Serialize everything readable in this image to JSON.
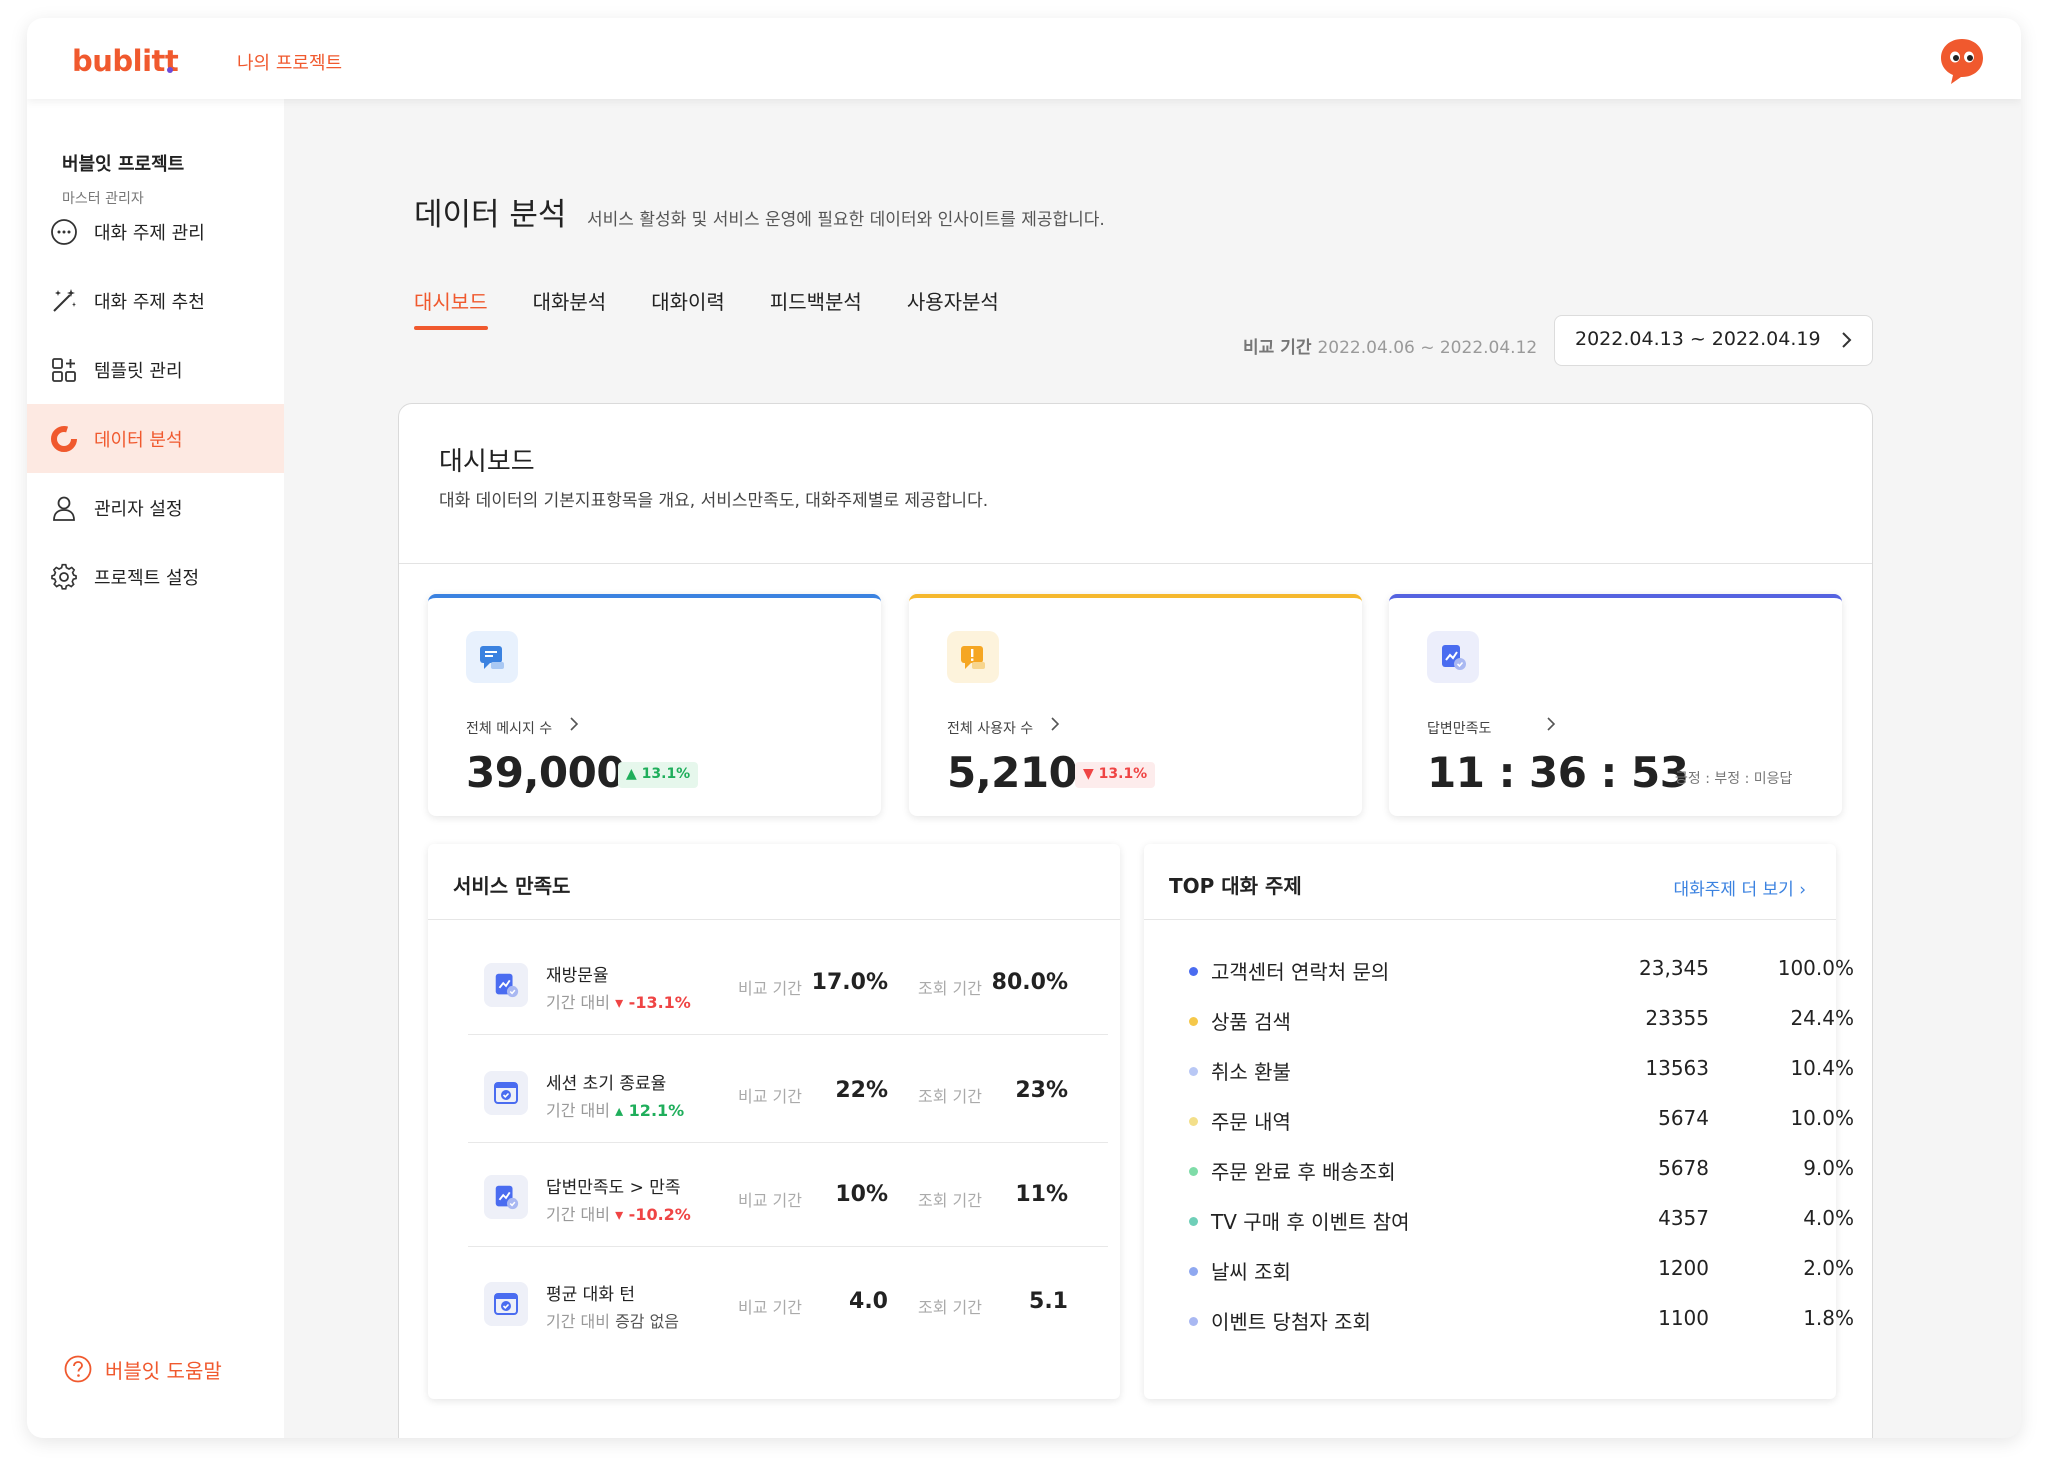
{
  "brand": {
    "logo": "bublitt",
    "accent": "#f0592e"
  },
  "topbar": {
    "project_link": "나의 프로젝트",
    "avatar_icon": "chat-bubble-eyes-icon"
  },
  "sidebar": {
    "project_name": "버블잇 프로젝트",
    "role": "마스터 관리자",
    "items": [
      {
        "label": "대화 주제 관리",
        "icon": "chat-bubble-dots-icon",
        "active": false
      },
      {
        "label": "대화 주제 추천",
        "icon": "magic-wand-icon",
        "active": false
      },
      {
        "label": "템플릿 관리",
        "icon": "template-grid-icon",
        "active": false
      },
      {
        "label": "데이터 분석",
        "icon": "donut-chart-icon",
        "active": true
      },
      {
        "label": "관리자 설정",
        "icon": "user-icon",
        "active": false
      },
      {
        "label": "프로젝트 설정",
        "icon": "gear-icon",
        "active": false
      }
    ],
    "help_label": "버블잇 도움말"
  },
  "page": {
    "title": "데이터 분석",
    "description": "서비스 활성화 및 서비스 운영에 필요한 데이터와 인사이트를 제공합니다.",
    "tabs": [
      "대시보드",
      "대화분석",
      "대화이력",
      "피드백분석",
      "사용자분석"
    ],
    "active_tab": 0,
    "compare_label": "비교 기간",
    "compare_range": "2022.04.06 ~ 2022.04.12",
    "date_range": "2022.04.13 ~ 2022.04.19"
  },
  "dashboard": {
    "title": "대시보드",
    "description": "대화 데이터의 기본지표항목을 개요, 서비스만족도, 대화주제별로 제공합니다."
  },
  "kpis": [
    {
      "label": "전체 메시지 수",
      "value": "39,000",
      "badge": "13.1%",
      "trend": "up",
      "color": "#3b82e0",
      "icon": "message-icon"
    },
    {
      "label": "전체 사용자 수",
      "value": "5,210",
      "badge": "13.1%",
      "trend": "down",
      "color": "#f5b82e",
      "icon": "alert-message-icon"
    },
    {
      "label": "답변만족도",
      "value": "11 : 36 : 53",
      "sub": "긍정 : 부정 : 미응답",
      "color": "#5563e0",
      "icon": "satisfaction-icon"
    }
  ],
  "satisfaction": {
    "title": "서비스 만족도",
    "compare_label": "비교 기간",
    "query_label": "조회 기간",
    "delta_prefix": "기간 대비",
    "rows": [
      {
        "name": "재방문율",
        "delta": "-13.1%",
        "trend": "down",
        "compare": "17.0%",
        "query": "80.0%",
        "icon": "chart-doc-icon"
      },
      {
        "name": "세션 초기 종료율",
        "delta": "12.1%",
        "trend": "up",
        "compare": "22%",
        "query": "23%",
        "icon": "calendar-check-icon"
      },
      {
        "name": "답변만족도 > 만족",
        "delta": "-10.2%",
        "trend": "down",
        "compare": "10%",
        "query": "11%",
        "icon": "chart-doc-icon"
      },
      {
        "name": "평균 대화 턴",
        "delta": "증감 없음",
        "trend": "flat",
        "compare": "4.0",
        "query": "5.1",
        "icon": "calendar-check-icon"
      }
    ]
  },
  "top_topics": {
    "title": "TOP 대화 주제",
    "more_label": "대화주제 더 보기",
    "rows": [
      {
        "name": "고객센터 연락처 문의",
        "count": "23,345",
        "pct": "100.0%",
        "color": "#4a6cf0"
      },
      {
        "name": "상품 검색",
        "count": "23355",
        "pct": "24.4%",
        "color": "#f5c84a"
      },
      {
        "name": "취소 환불",
        "count": "13563",
        "pct": "10.4%",
        "color": "#b9c8f5"
      },
      {
        "name": "주문 내역",
        "count": "5674",
        "pct": "10.0%",
        "color": "#f3df8a"
      },
      {
        "name": "주문 완료 후 배송조회",
        "count": "5678",
        "pct": "9.0%",
        "color": "#7fdca8"
      },
      {
        "name": "TV 구매 후 이벤트 참여",
        "count": "4357",
        "pct": "4.0%",
        "color": "#6fcfb8"
      },
      {
        "name": "날씨 조회",
        "count": "1200",
        "pct": "2.0%",
        "color": "#8fa8f0"
      },
      {
        "name": "이벤트 당첨자 조회",
        "count": "1100",
        "pct": "1.8%",
        "color": "#a9b8f2"
      }
    ]
  }
}
